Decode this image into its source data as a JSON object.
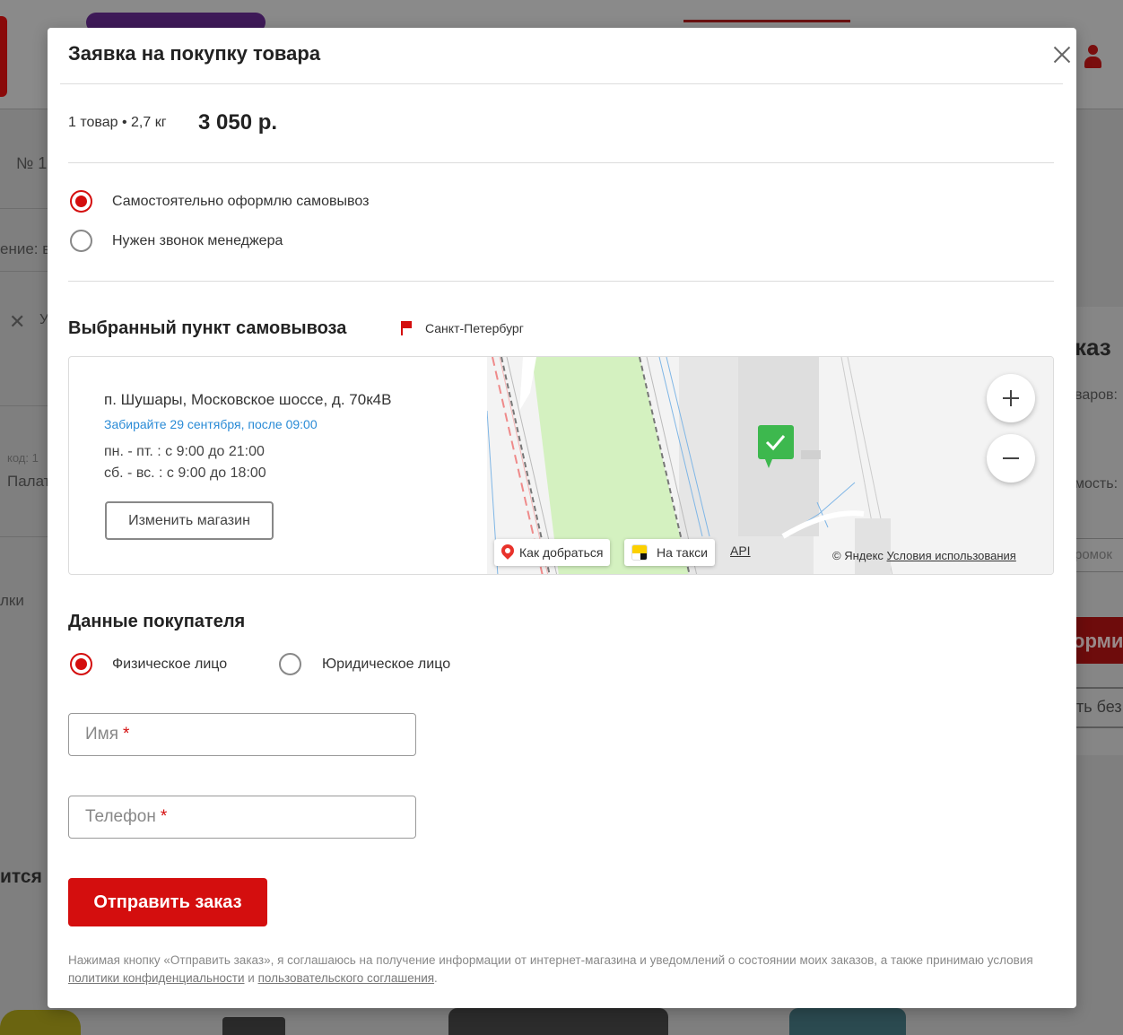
{
  "background": {
    "number_prefix": "№ 1",
    "partial_left_1": "ение: в",
    "partial_left_2": "код: 1",
    "partial_left_3": "Палат",
    "partial_left_4": "лки",
    "partial_left_5": "ится",
    "partial_right_1": "каз",
    "partial_right_2": "варов:",
    "partial_right_3": "мость:",
    "partial_right_4": "ромок",
    "partial_right_5": "ормит",
    "partial_right_6": "ть без",
    "partial_close_text": "У"
  },
  "modal": {
    "title": "Заявка на покупку товара",
    "summary": {
      "count": "1 товар • 2,7 кг",
      "price": "3 050 р."
    },
    "order_method": [
      {
        "label": "Самостоятельно оформлю самовывоз",
        "checked": true
      },
      {
        "label": "Нужен звонок менеджера",
        "checked": false
      }
    ],
    "pickup": {
      "title": "Выбранный пункт самовывоза",
      "city": "Санкт-Петербург",
      "address": "п. Шушары, Московское шоссе, д. 70к4В",
      "pickup_date": "Забирайте 29 сентября, после 09:00",
      "hours_weekdays": "пн. - пт. : с 9:00 до 21:00",
      "hours_weekend": "сб. - вс. : с 9:00 до 18:00",
      "change_button": "Изменить магазин"
    },
    "map": {
      "route_label": "Как добраться",
      "taxi_label": "На такси",
      "api_label": "API",
      "copyright": "© Яндекс",
      "terms_label": "Условия использования"
    },
    "buyer": {
      "title": "Данные покупателя",
      "types": [
        {
          "label": "Физическое лицо",
          "checked": true
        },
        {
          "label": "Юридическое лицо",
          "checked": false
        }
      ],
      "name_placeholder": "Имя",
      "phone_placeholder": "Телефон",
      "required_mark": "*"
    },
    "submit_label": "Отправить заказ",
    "legal": {
      "text_before": "Нажимая кнопку «Отправить заказ», я соглашаюсь на получение информации от интернет-магазина и уведомлений о состоянии моих заказов, а также принимаю условия ",
      "privacy_link": "политики конфиденциальности",
      "and": " и ",
      "agreement_link": "пользовательского соглашения",
      "end": "."
    }
  },
  "colors": {
    "accent": "#d40e0e",
    "link_blue": "#2a8bd6",
    "map_park": "#d4f1c0",
    "pin_green": "#3db84e"
  }
}
